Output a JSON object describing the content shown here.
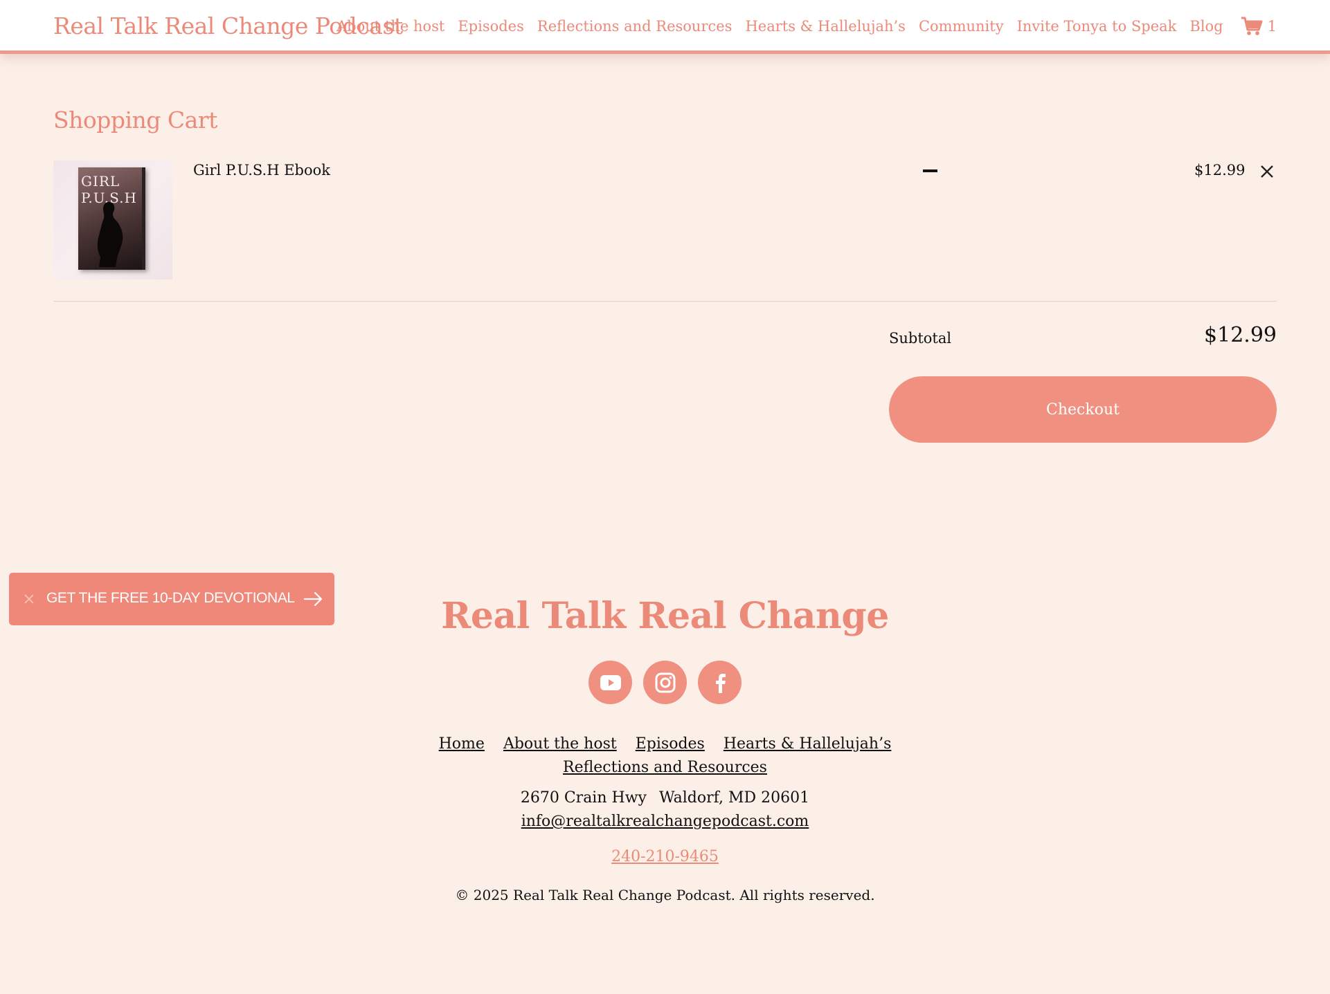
{
  "header": {
    "site_title": "Real Talk Real Change Podcast",
    "nav": [
      "About the host",
      "Episodes",
      "Reflections and Resources",
      "Hearts & Hallelujah’s",
      "Community",
      "Invite Tonya to Speak",
      "Blog"
    ],
    "cart_count": "1",
    "cart_icon": "cart-icon"
  },
  "cart": {
    "heading": "Shopping Cart",
    "item": {
      "name": "Girl P.U.S.H Ebook",
      "cover_title_line1": "GIRL",
      "cover_title_line2": "P.U.S.H",
      "price": "$12.99"
    },
    "subtotal_label": "Subtotal",
    "subtotal_value": "$12.99",
    "checkout_label": "Checkout"
  },
  "promo": {
    "text": "GET THE FREE 10-DAY DEVOTIONAL"
  },
  "footer": {
    "title": "Real Talk Real Change",
    "socials": [
      "youtube-icon",
      "instagram-icon",
      "facebook-icon"
    ],
    "links_row1": [
      "Home",
      "About the host",
      "Episodes",
      "Hearts & Hallelujah’s"
    ],
    "links_row2": [
      "Reflections and Resources"
    ],
    "address_street": "2670 Crain Hwy",
    "address_city": "Waldorf, MD 20601",
    "email": "info@realtalkrealchangepodcast.com",
    "phone": "240-210-9465",
    "copyright": "© 2025 Real Talk Real Change Podcast. All rights reserved."
  },
  "colors": {
    "accent": "#ec8a79",
    "button": "#f09080",
    "background": "#fcefe8"
  }
}
